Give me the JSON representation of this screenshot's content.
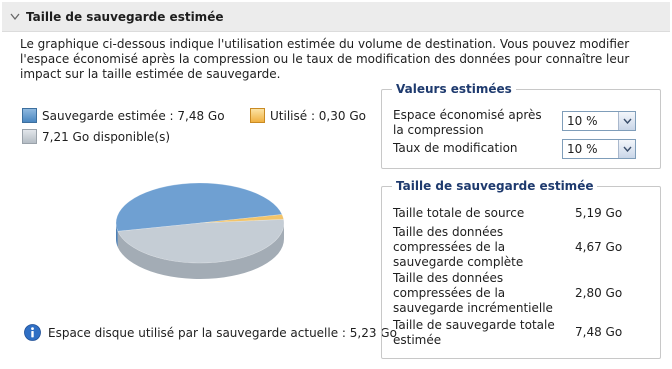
{
  "header": {
    "title": "Taille de sauvegarde estimée",
    "toggle_icon": "chevron-down-icon"
  },
  "description": "Le graphique ci-dessous indique l'utilisation estimée du volume de destination. Vous pouvez modifier l'espace économisé après la compression ou le taux de modification des données pour connaître leur impact sur la taille estimée de sauvegarde.",
  "legend": {
    "backup": "Sauvegarde estimée : 7,48 Go",
    "used": "Utilisé : 0,30 Go",
    "available": "7,21 Go disponible(s)"
  },
  "colors": {
    "backup": "#6fa0d2",
    "used": "#f2c46a",
    "available": "#c5cdd5"
  },
  "chart_data": {
    "type": "pie",
    "categories": [
      "Sauvegarde estimée",
      "Utilisé",
      "disponible(s)"
    ],
    "values": [
      7.48,
      0.3,
      7.21
    ]
  },
  "info": {
    "icon": "info-icon",
    "text": "Espace disque utilisé par la sauvegarde actuelle : 5,23 Go"
  },
  "estimated_values": {
    "title": "Valeurs estimées",
    "compression_label": "Espace économisé après la compression",
    "compression_value": "10 %",
    "change_rate_label": "Taux de modification",
    "change_rate_value": "10 %"
  },
  "backup_size": {
    "title": "Taille de sauvegarde estimée",
    "rows": [
      {
        "label": "Taille totale de source",
        "value": "5,19 Go"
      },
      {
        "label": "Taille des données compressées de la sauvegarde complète",
        "value": "4,67 Go"
      },
      {
        "label": "Taille des données compressées de la sauvegarde incrémentielle",
        "value": "2,80 Go"
      },
      {
        "label": "Taille de sauvegarde totale estimée",
        "value": "7,48 Go"
      }
    ]
  }
}
